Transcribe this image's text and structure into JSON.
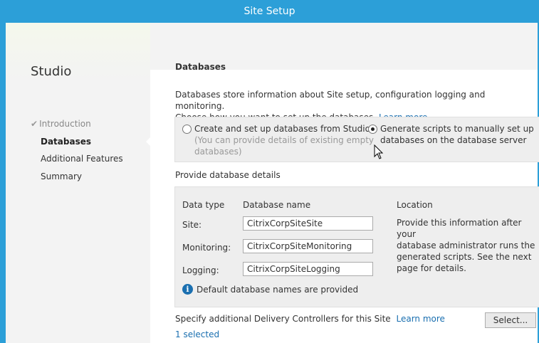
{
  "window": {
    "title": "Site Setup"
  },
  "sidebar": {
    "app_name": "Studio",
    "items": [
      {
        "label": "Introduction",
        "state": "done"
      },
      {
        "label": "Databases",
        "state": "active"
      },
      {
        "label": "Additional Features",
        "state": "pending"
      },
      {
        "label": "Summary",
        "state": "pending"
      }
    ]
  },
  "page": {
    "title": "Databases",
    "intro_line1": "Databases store information about Site setup, configuration logging and monitoring.",
    "intro_line2": "Choose how you want to set up the databases.",
    "learn_more": "Learn more"
  },
  "options": [
    {
      "label": "Create and set up databases from Studio",
      "sub_line1": "(You can provide details of existing empty",
      "sub_line2": "databases)",
      "selected": false
    },
    {
      "label_line1": "Generate scripts to manually set up",
      "label_line2": "databases on the database server",
      "selected": true
    }
  ],
  "details": {
    "section_label": "Provide database details",
    "col_data_type": "Data type",
    "col_db_name": "Database name",
    "col_location": "Location",
    "rows": [
      {
        "label": "Site:",
        "value": "CitrixCorpSiteSite"
      },
      {
        "label": "Monitoring:",
        "value": "CitrixCorpSiteMonitoring"
      },
      {
        "label": "Logging:",
        "value": "CitrixCorpSiteLogging"
      }
    ],
    "location_text_1": "Provide this information after your",
    "location_text_2": "database administrator runs the",
    "location_text_3": "generated scripts. See the next",
    "location_text_4": "page for details.",
    "info_note": "Default database names are provided"
  },
  "controllers": {
    "label": "Specify additional Delivery Controllers for this Site",
    "learn_more": "Learn more",
    "selected_count": "1 selected",
    "select_button": "Select..."
  },
  "colors": {
    "accent": "#2c9fd8",
    "link": "#1a6fb0"
  }
}
